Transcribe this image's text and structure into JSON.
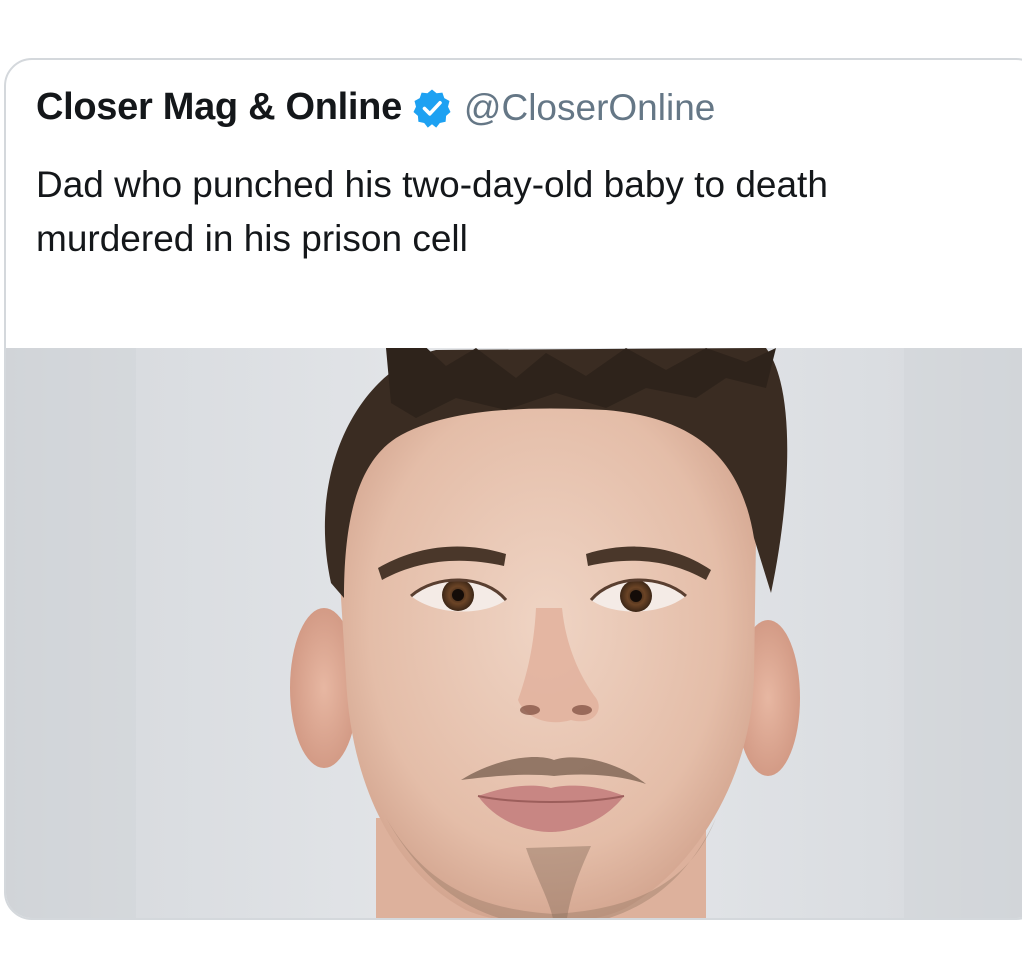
{
  "tweet": {
    "author_name": "Closer Mag & Online",
    "verified_icon": "verified-badge-icon",
    "handle": "@CloserOnline",
    "text": "Dad who punched his two-day-old baby to death murdered in his prison cell"
  },
  "colors": {
    "text_primary": "#14171a",
    "text_secondary": "#657786",
    "verified_blue": "#1da1f2",
    "card_border": "#d4d8dc",
    "photo_background": "#e3e5e8"
  }
}
